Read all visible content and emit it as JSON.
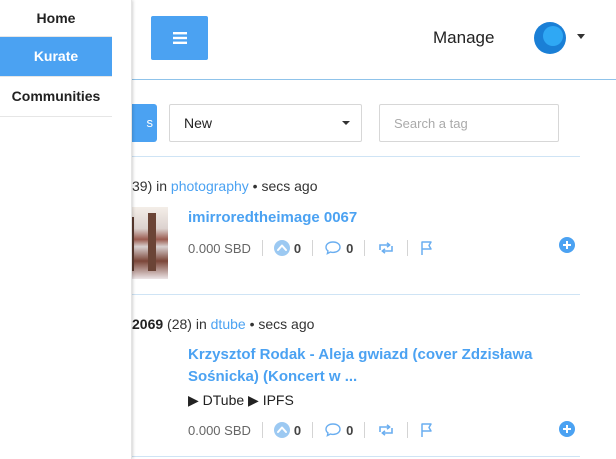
{
  "sidebar": {
    "items": [
      {
        "label": "Home",
        "active": false
      },
      {
        "label": "Kurate",
        "active": true
      },
      {
        "label": "Communities",
        "active": false
      }
    ]
  },
  "header": {
    "menu_icon": "hamburger-menu-icon",
    "manage_label": "Manage",
    "avatar_icon": "user-avatar"
  },
  "filters": {
    "left_button_label": "s",
    "sort_select_value": "New",
    "tag_search_placeholder": "Search a tag"
  },
  "posts": [
    {
      "author": "",
      "reputation": "39)",
      "in_label": "in",
      "category": "photography",
      "time": "secs ago",
      "title": "imirroredtheimage 0067",
      "body": "",
      "payout": "0.000 SBD",
      "votes": "0",
      "comments": "0"
    },
    {
      "author": "2069",
      "reputation": "(28)",
      "in_label": "in",
      "category": "dtube",
      "time": "secs ago",
      "title": "Krzysztof Rodak - Aleja gwiazd (cover Zdzisława Sośnicka) (Koncert w ...",
      "body": "▶ DTube ▶ IPFS",
      "payout": "0.000 SBD",
      "votes": "0",
      "comments": "0"
    }
  ],
  "colors": {
    "accent": "#4ba2f2",
    "divider": "#cfe4f5"
  }
}
